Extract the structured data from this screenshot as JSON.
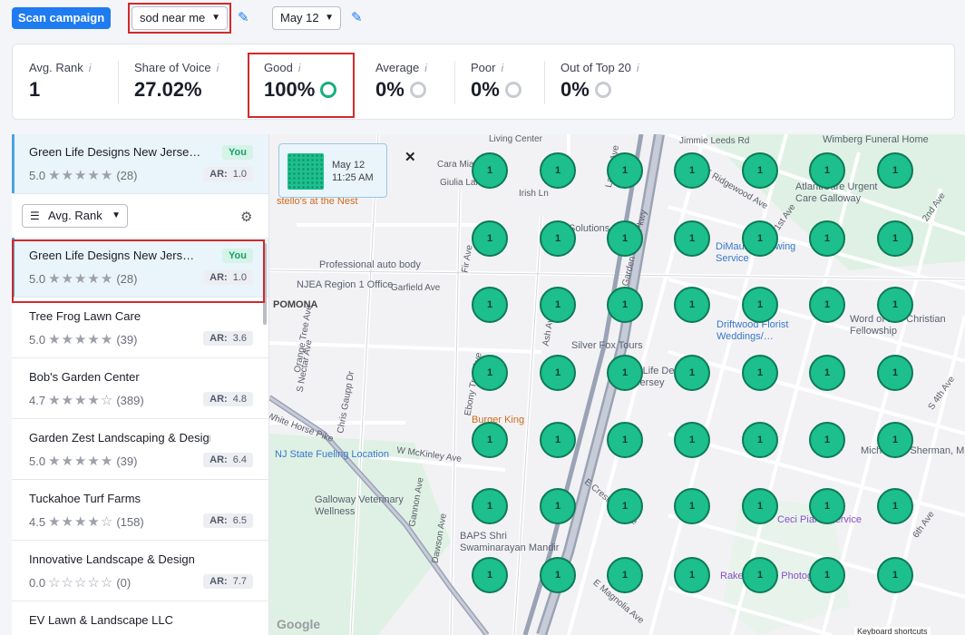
{
  "toolbar": {
    "scan_label": "Scan campaign",
    "keyword": "sod near me",
    "date": "May 12"
  },
  "metrics": [
    {
      "label": "Avg. Rank",
      "value": "1"
    },
    {
      "label": "Share of Voice",
      "value": "27.02%"
    },
    {
      "label": "Good",
      "value": "100%"
    },
    {
      "label": "Average",
      "value": "0%"
    },
    {
      "label": "Poor",
      "value": "0%"
    },
    {
      "label": "Out of Top 20",
      "value": "0%"
    }
  ],
  "info_glyph": "i",
  "sort": {
    "label": "Avg. Rank"
  },
  "pinned": {
    "name": "Green Life Designs New Jerse…",
    "rating": "5.0",
    "reviews": "(28)",
    "ar": "1.0",
    "badge": "You"
  },
  "businesses": [
    {
      "name": "Green Life Designs New Jers…",
      "rating": "5.0",
      "reviews": "(28)",
      "ar": "1.0",
      "badge": "You",
      "stars": 5
    },
    {
      "name": "Tree Frog Lawn Care",
      "rating": "5.0",
      "reviews": "(39)",
      "ar": "3.6",
      "stars": 5
    },
    {
      "name": "Bob's Garden Center",
      "rating": "4.7",
      "reviews": "(389)",
      "ar": "4.8",
      "stars": 4
    },
    {
      "name": "Garden Zest Landscaping & Design",
      "rating": "5.0",
      "reviews": "(39)",
      "ar": "6.4",
      "stars": 5
    },
    {
      "name": "Tuckahoe Turf Farms",
      "rating": "4.5",
      "reviews": "(158)",
      "ar": "6.5",
      "stars": 4
    },
    {
      "name": "Innovative Landscape & Design",
      "rating": "0.0",
      "reviews": "(0)",
      "ar": "7.7",
      "stars": 0
    },
    {
      "name": "EV Lawn & Landscape LLC",
      "rating": "",
      "reviews": "",
      "ar": "",
      "stars": 0
    }
  ],
  "ar_label": "AR:",
  "map": {
    "card_date": "May 12",
    "card_time": "11:25 AM",
    "pin_rank": "1",
    "google": "Google",
    "keyboard": "Keyboard shortcuts",
    "road_labels": [
      "Jimmie Leeds Rd",
      "Cara Mia Lane",
      "Giulia Lane",
      "Irish Ln",
      "Laurel Ave",
      "Garden State Pkwy",
      "E Ridgewood Ave",
      "S 1st Ave",
      "2nd Ave",
      "Garfield Ave",
      "Fir Ave",
      "Ash Ave",
      "Ebony Tree Ave",
      "S Nectar Ave",
      "Chris Gaupp Dr",
      "White Horse Pike",
      "W McKinley Ave",
      "Dawson Ave",
      "E Crestview Ave",
      "E Magnolia Ave",
      "Living Center",
      "Gannon Ave",
      "Orange Tree Ave",
      "S 4th Ave",
      "6th Ave",
      "Wimberg Funeral Home"
    ],
    "pois": [
      "Professional auto body",
      "NJEA Region 1 Office",
      "POMONA",
      "stello's at the Nest",
      "DiMauro's Sewing Service",
      "Driftwood Florist Weddings/…",
      "Word of Life Christian Fellowship",
      "AtlantiCare Urgent Care Galloway",
      "Silver Fox Tours",
      "Green Life Designs New Jersey",
      "Burger King",
      "NJ State Fueling Location",
      "Galloway Veterinary Wellness",
      "BAPS Shri Swaminarayan Mandir",
      "Ceci Piano Service",
      "Rakesh Love Photography",
      "Michael E. Sherman, MS",
      "Solutions"
    ]
  }
}
